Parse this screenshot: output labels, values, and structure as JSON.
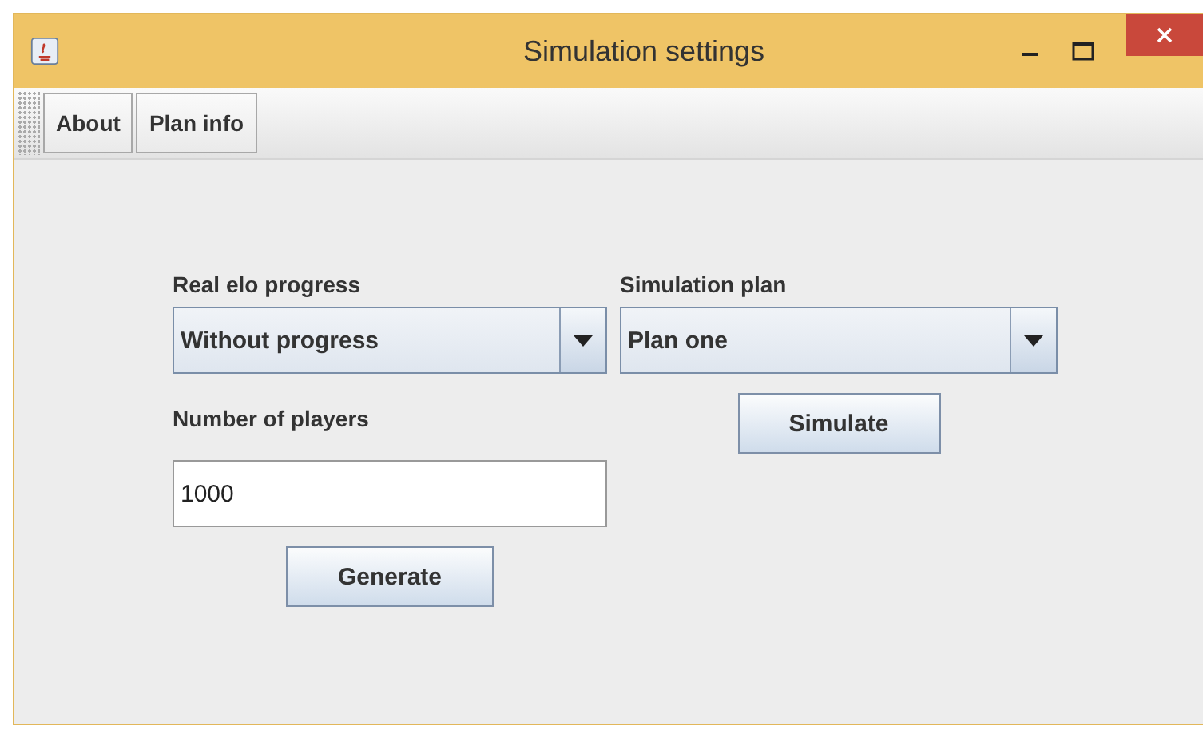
{
  "window": {
    "title": "Simulation settings"
  },
  "toolbar": {
    "buttons": [
      "About",
      "Plan info"
    ]
  },
  "form": {
    "progress": {
      "label": "Real elo progress",
      "value": "Without progress"
    },
    "plan": {
      "label": "Simulation plan",
      "value": "Plan one"
    },
    "players": {
      "label": "Number of players",
      "value": "1000"
    },
    "generate": "Generate",
    "simulate": "Simulate"
  }
}
